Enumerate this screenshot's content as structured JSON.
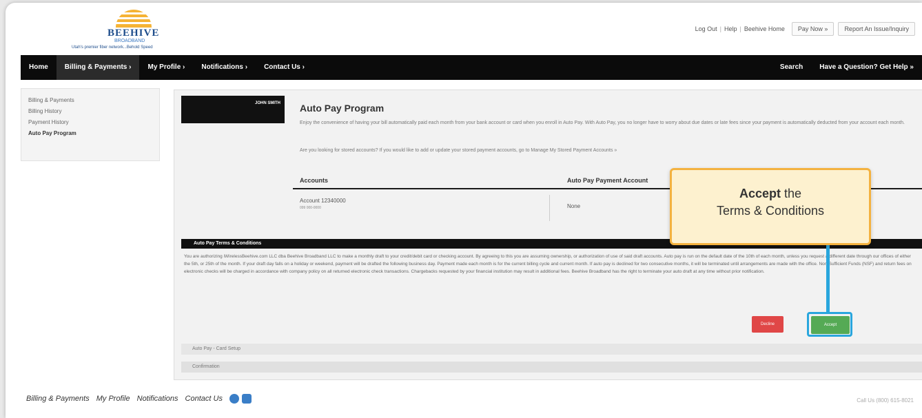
{
  "header": {
    "brand": "BEEHIVE",
    "brand_sub": "BROADBAND",
    "tagline": "Utah's premier fiber network...Behold Speed",
    "links": [
      "Log Out",
      "Help",
      "Beehive Home"
    ],
    "pay_now": "Pay Now »",
    "report_issue": "Report An Issue/Inquiry"
  },
  "nav": {
    "items": [
      "Home",
      "Billing & Payments ›",
      "My Profile ›",
      "Notifications ›",
      "Contact Us ›"
    ],
    "search": "Search",
    "help": "Have a Question? Get Help »"
  },
  "sidebar": {
    "items": [
      "Billing & Payments",
      "Billing History",
      "Payment History",
      "Auto Pay Program"
    ]
  },
  "main": {
    "customer_name": "JOHN SMITH",
    "title": "Auto Pay Program",
    "description": "Enjoy the convenience of having your bill automatically paid each month from your bank account or card when you enroll in Auto Pay. With Auto Pay, you no longer have to worry about due dates or late fees since your payment is automatically deducted from your account each month.",
    "question": "Are you looking for stored accounts? If you would like to add or update your stored payment accounts, go to Manage My Stored Payment Accounts »",
    "accounts_header": "Accounts",
    "autopay_header": "Auto Pay Payment Account",
    "account_label": "Account",
    "account_number": "12340000",
    "account_sub": "099 000-0000",
    "autopay_value": "None",
    "terms_header": "Auto Pay Terms & Conditions",
    "terms_text": "You are authorizing iWirelessBeehive.com LLC dba Beehive Broadband LLC to make a monthly draft to your credit/debit card or checking account. By agreeing to this you are assuming ownership, or authorization of use of said draft accounts. Auto pay is run on the default date of the 10th of each month, unless you request a different date through our offices of either the 5th, or 25th of the month. If your draft day falls on a holiday or weekend, payment will be drafted the following business day. Payment made each month is for the current billing cycle and current month. If auto pay is declined for two consecutive months, it will be terminated until arrangements are made with the office. Non-Sufficient Funds (NSF) and return fees on electronic checks will be charged in accordance with company policy on all returned electronic check transactions. Chargebacks requested by your financial institution may result in additional fees. Beehive Broadband has the right to terminate your auto draft at any time without prior notification.",
    "decline": "Decline",
    "accept": "Accept",
    "step_card": "Auto Pay - Card Setup",
    "step_confirm": "Confirmation"
  },
  "callout": {
    "bold": "Accept",
    "rest": " the",
    "line2": "Terms & Conditions"
  },
  "footer": {
    "links": [
      "Billing & Payments",
      "My Profile",
      "Notifications",
      "Contact Us"
    ],
    "call": "Call Us (800) 615-8021"
  },
  "colors": {
    "accent_blue": "#29a6dd",
    "callout_border": "#f4b23f",
    "callout_bg": "#fdf1cf",
    "accept_green": "#55aa55",
    "decline_red": "#e04747"
  },
  "icons": [
    "sun-logo-icon",
    "facebook-icon",
    "twitter-icon"
  ]
}
